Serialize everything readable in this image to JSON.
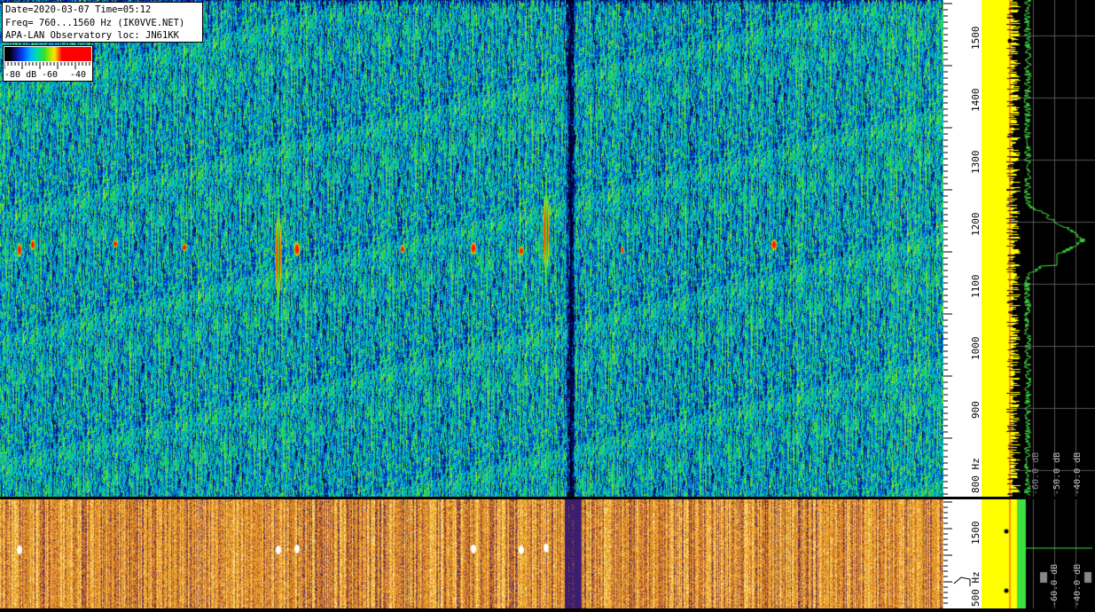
{
  "header": {
    "line1": "Date=2020-03-07 Time=05:12",
    "line2": "Freq= 760...1560 Hz (IK0VVE.NET)",
    "line3": "APA-LAN Observatory loc: JN61KK"
  },
  "legend": {
    "label_min": "-80 dB",
    "label_mid": "-60",
    "label_max": "-40"
  },
  "freq_scale_top": {
    "ticks": [
      "1500",
      "1400",
      "1300",
      "1200",
      "1100",
      "1000",
      "900",
      "800 Hz"
    ]
  },
  "freq_scale_bottom": {
    "ticks": [
      "1500",
      "500 Hz"
    ]
  },
  "spectrum_top": {
    "db_labels": [
      "-60.0 dB",
      "-50.0 dB",
      "-40.0 dB"
    ]
  },
  "spectrum_bottom": {
    "db_labels": [
      "-60.0 dB",
      "-40.0 dB"
    ]
  },
  "colors": {
    "waterfall_bg": "#2a8fb0",
    "signal_red": "#ff0000",
    "spectrum_yellow": "#ffff00",
    "spectrum_green": "#30e030",
    "bottom_waterfall": "#e8a030"
  }
}
